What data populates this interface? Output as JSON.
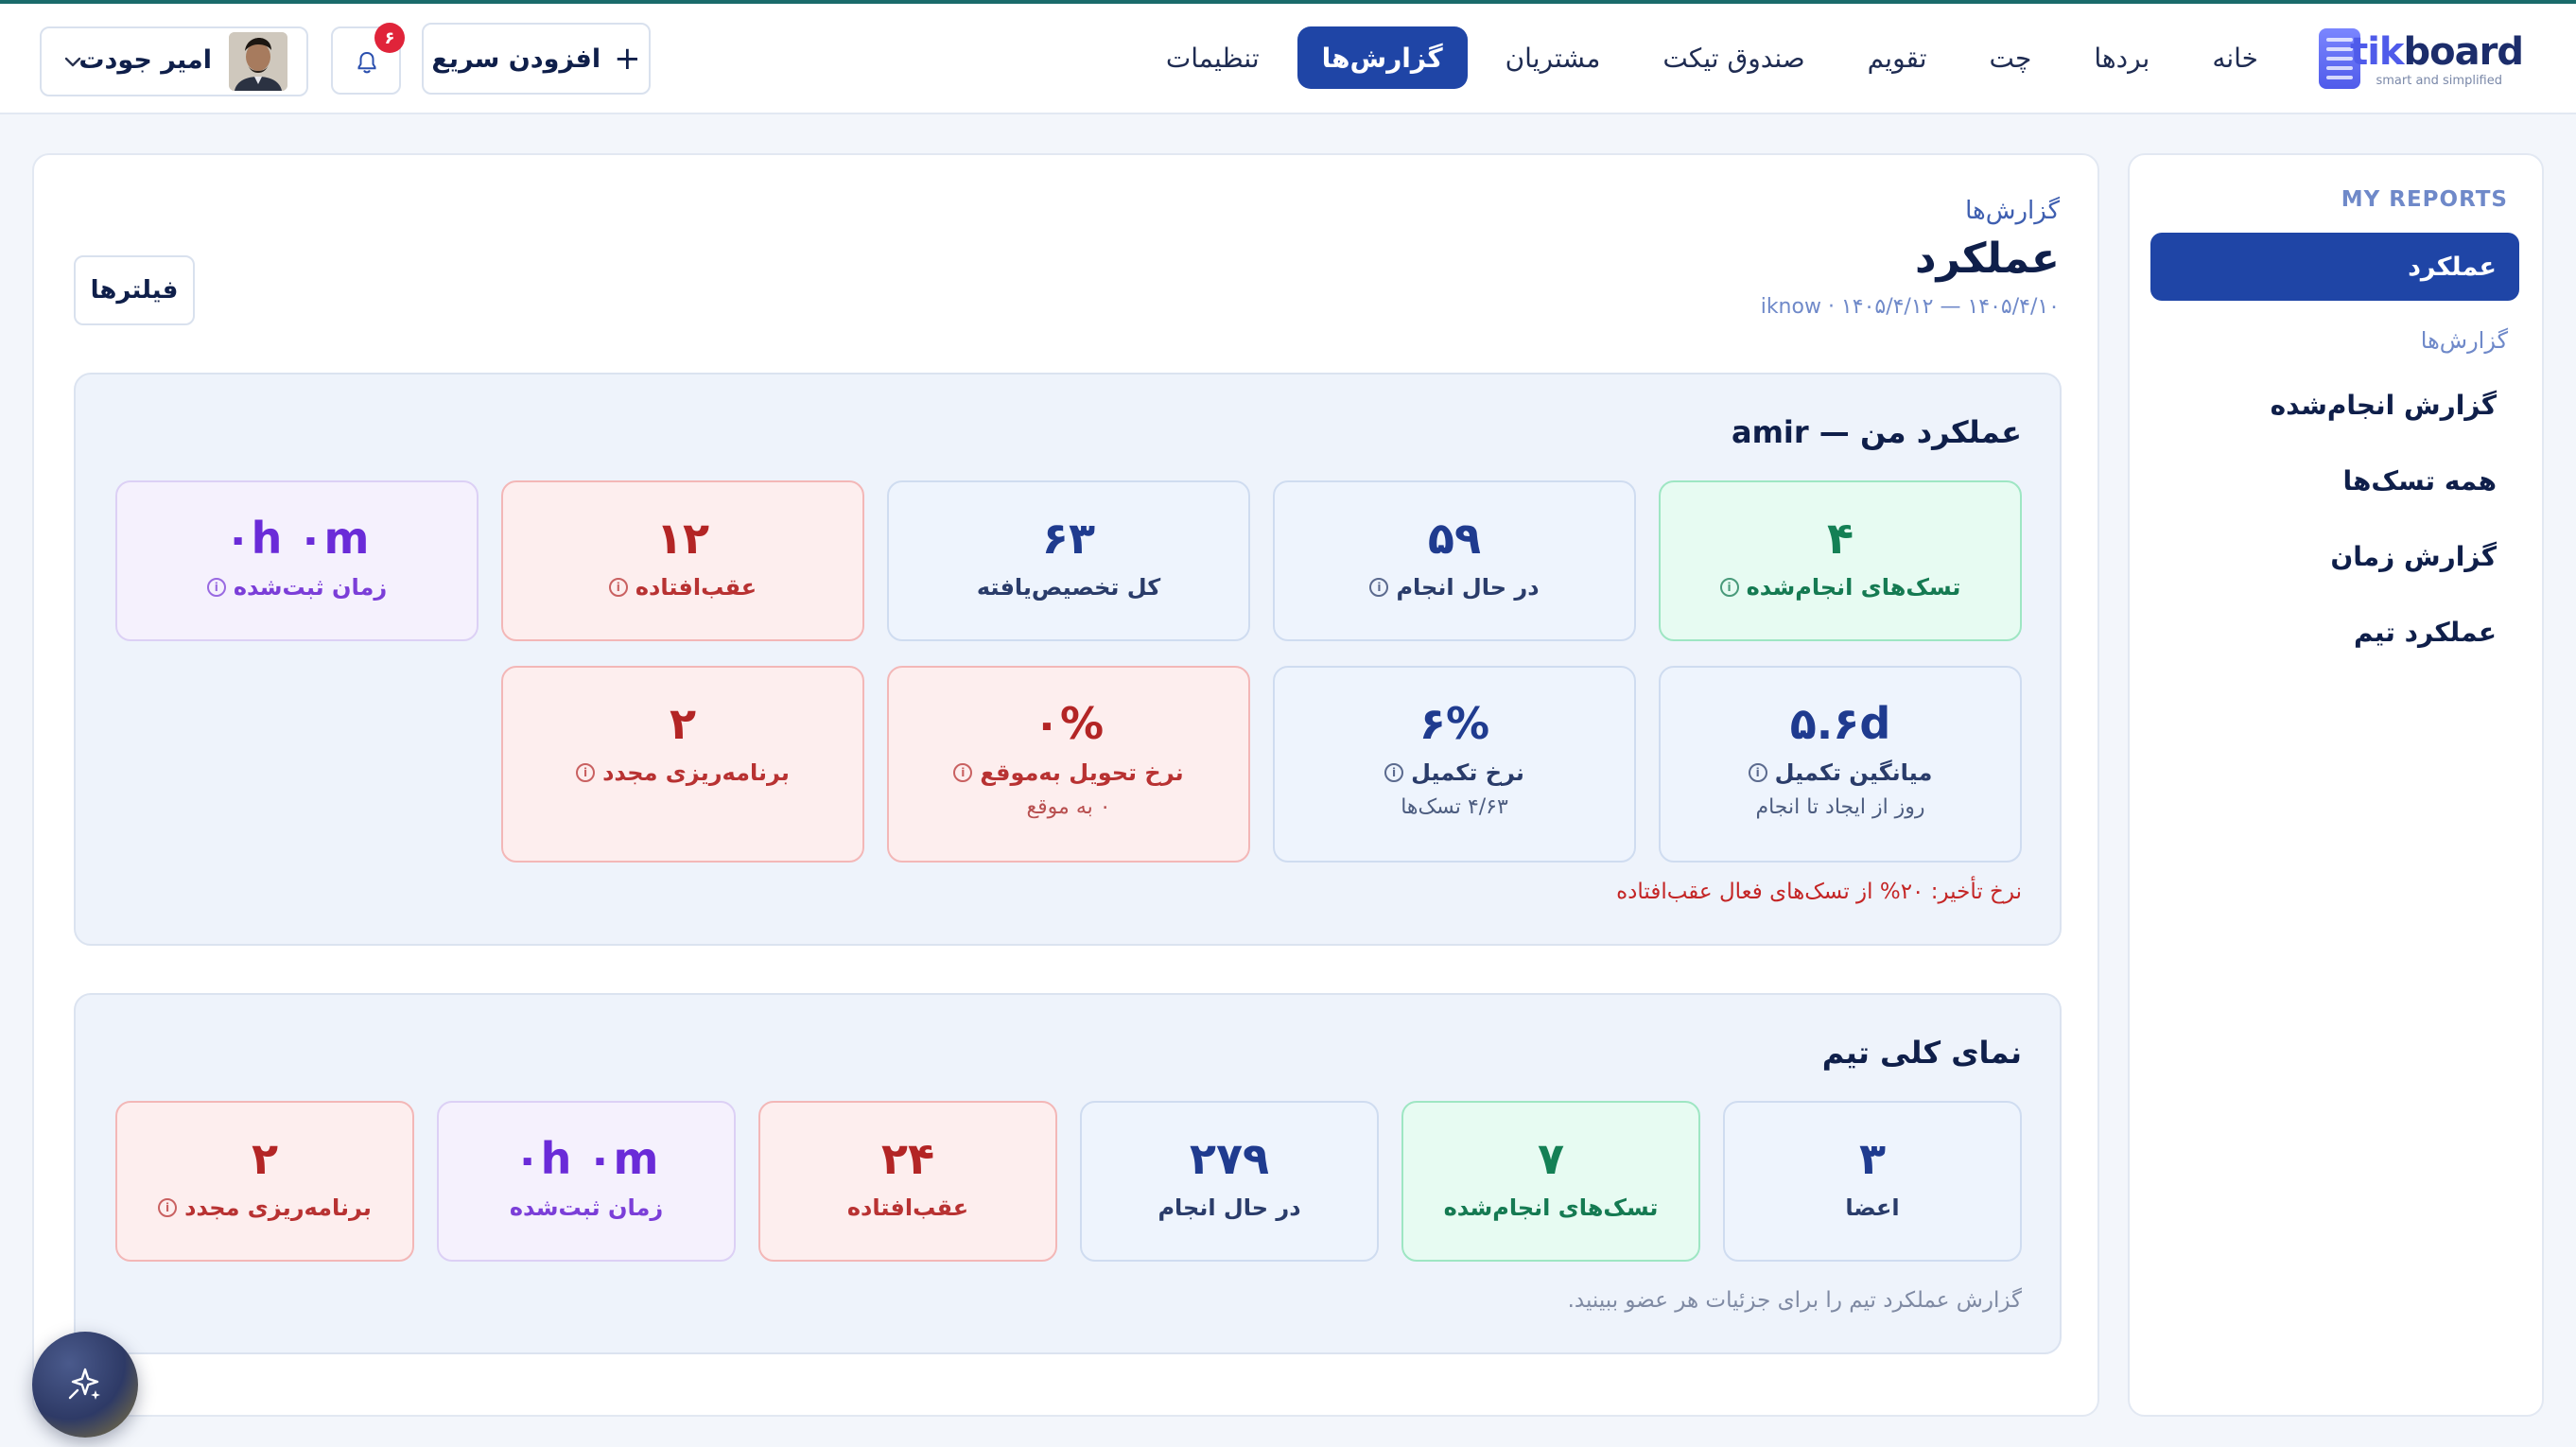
{
  "brand": {
    "name_a": "tik",
    "name_b": "board",
    "tagline": "smart and simplified"
  },
  "nav": [
    "خانه",
    "بردها",
    "چت",
    "تقویم",
    "صندوق تیکت",
    "مشتریان",
    "گزارش‌ها",
    "تنظیمات"
  ],
  "nav_active_index": 6,
  "header": {
    "quick_add": "افزودن سریع",
    "notifications_count": "۶",
    "user_name": "امیر جودت"
  },
  "sidebar": {
    "heading": "MY REPORTS",
    "active": "عملکرد",
    "subheading": "گزارش‌ها",
    "links": [
      "گزارش انجام‌شده",
      "همه تسک‌ها",
      "گزارش زمان",
      "عملکرد تیم"
    ]
  },
  "page": {
    "breadcrumb": "گزارش‌ها",
    "title": "عملکرد",
    "date_range": "iknow · ۱۴۰۵/۴/۱۲ — ۱۴۰۵/۴/۱۰",
    "filters": "فیلترها"
  },
  "my_performance": {
    "title": "عملکرد من — amir",
    "row1": [
      {
        "value": "۴",
        "label": "تسک‌های انجام‌شده",
        "tone": "green",
        "info": true
      },
      {
        "value": "۵۹",
        "label": "در حال انجام",
        "tone": "blue",
        "info": true
      },
      {
        "value": "۶۳",
        "label": "کل تخصیص‌یافته",
        "tone": "blue",
        "info": false
      },
      {
        "value": "۱۲",
        "label": "عقب‌افتاده",
        "tone": "red",
        "info": true
      },
      {
        "value": "۰h ۰m",
        "label": "زمان ثبت‌شده",
        "tone": "purple",
        "info": true
      }
    ],
    "row2": [
      {
        "value": "۵.۶d",
        "label": "میانگین تکمیل",
        "sub": "روز از ایجاد تا انجام",
        "tone": "blue",
        "info": true
      },
      {
        "value": "۶%",
        "label": "نرخ تکمیل",
        "sub": "۴/۶۳ تسک‌ها",
        "tone": "blue",
        "info": true
      },
      {
        "value": "۰%",
        "label": "نرخ تحویل به‌موقع",
        "sub": "۰ به موقع",
        "tone": "red",
        "info": true
      },
      {
        "value": "۲",
        "label": "برنامه‌ریزی مجدد",
        "sub": "",
        "tone": "red",
        "info": true
      }
    ],
    "late_note": "نرخ تأخیر: ۲۰% از تسک‌های فعال عقب‌افتاده"
  },
  "team_overview": {
    "title": "نمای کلی تیم",
    "cards": [
      {
        "value": "۳",
        "label": "اعضا",
        "tone": "blue",
        "info": false
      },
      {
        "value": "۷",
        "label": "تسک‌های انجام‌شده",
        "tone": "green",
        "info": false
      },
      {
        "value": "۲۷۹",
        "label": "در حال انجام",
        "tone": "blue",
        "info": false
      },
      {
        "value": "۲۴",
        "label": "عقب‌افتاده",
        "tone": "red",
        "info": false
      },
      {
        "value": "۰h ۰m",
        "label": "زمان ثبت‌شده",
        "tone": "purple",
        "info": false
      },
      {
        "value": "۲",
        "label": "برنامه‌ریزی مجدد",
        "tone": "red",
        "info": true
      }
    ],
    "note": "گزارش عملکرد تیم را برای جزئیات هر عضو ببینید."
  }
}
